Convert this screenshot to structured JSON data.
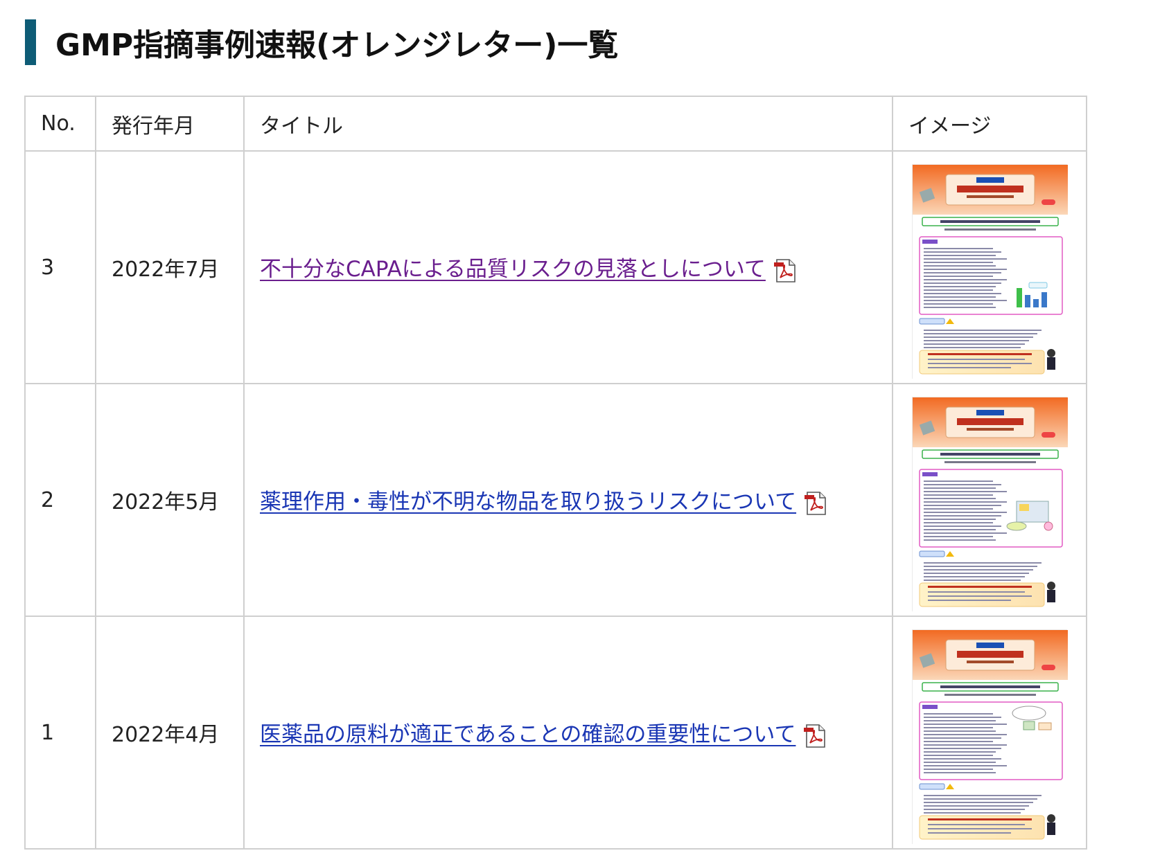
{
  "page": {
    "title": "GMP指摘事例速報(オレンジレター)一覧",
    "accent_color": "#0e5c76"
  },
  "table": {
    "headers": {
      "no": "No.",
      "date": "発行年月",
      "title": "タイトル",
      "image": "イメージ"
    },
    "rows": [
      {
        "no": "3",
        "date": "2022年7月",
        "title": "不十分なCAPAによる品質リスクの見落としについて",
        "visited": true,
        "icon": "pdf-icon",
        "thumb_chart": "bar-chart"
      },
      {
        "no": "2",
        "date": "2022年5月",
        "title": "薬理作用・毒性が不明な物品を取り扱うリスクについて",
        "visited": false,
        "icon": "pdf-icon",
        "thumb_chart": "equipment"
      },
      {
        "no": "1",
        "date": "2022年4月",
        "title": "医薬品の原料が適正であることの確認の重要性について",
        "visited": false,
        "icon": "pdf-icon",
        "thumb_chart": "diagram"
      }
    ]
  },
  "colors": {
    "link": "#1a36b4",
    "link_visited": "#6a1e8e",
    "border": "#cfcfcf",
    "thumb_orange": "#f0742a"
  }
}
